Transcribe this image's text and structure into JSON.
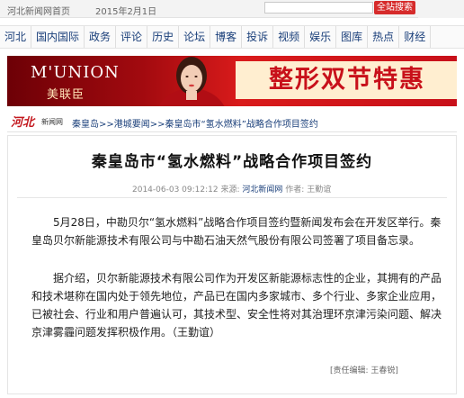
{
  "topbar": {
    "home_link": "河北新闻网首页",
    "date": "2015年2月1日",
    "search_placeholder": "",
    "search_button": "全站搜索"
  },
  "nav": {
    "items": [
      "河北",
      "国内国际",
      "政务",
      "评论",
      "历史",
      "论坛",
      "博客",
      "投诉",
      "视频",
      "娱乐",
      "图库",
      "热点",
      "财经"
    ]
  },
  "banner": {
    "brand_en": "M'UNION",
    "brand_cn": "美联臣",
    "promo": "整形双节特惠"
  },
  "breadcrumb": {
    "logo": "河北",
    "logo_sub": "新闻网",
    "path": [
      "秦皇岛",
      "港城要闻",
      "秦皇岛市“氢水燃料”战略合作项目签约"
    ],
    "separator": ">>"
  },
  "article": {
    "title": "秦皇岛市“氢水燃料”战略合作项目签约",
    "datetime": "2014-06-03 09:12:12",
    "source_label": "来源:",
    "source": "河北新闻网",
    "author_label": "作者:",
    "author": "王勤谊",
    "paragraphs": [
      "5月28日，中勘贝尔“氢水燃料”战略合作项目签约暨新闻发布会在开发区举行。秦皇岛贝尔新能源技术有限公司与中勘石油天然气股份有限公司签署了项目备忘录。",
      "据介绍，贝尔新能源技术有限公司作为开发区新能源标志性的企业，其拥有的产品和技术堪称在国内处于领先地位，产品已在国内多家城市、多个行业、多家企业应用，已被社会、行业和用户普遍认可，其技术型、安全性将对其治理环京津污染问题、解决京津雾霾问题发挥积极作用。（王勤谊）"
    ],
    "editor_label": "[责任编辑: 王春锐]"
  },
  "colors": {
    "accent": "#c8101a",
    "link": "#1a3f7a"
  }
}
